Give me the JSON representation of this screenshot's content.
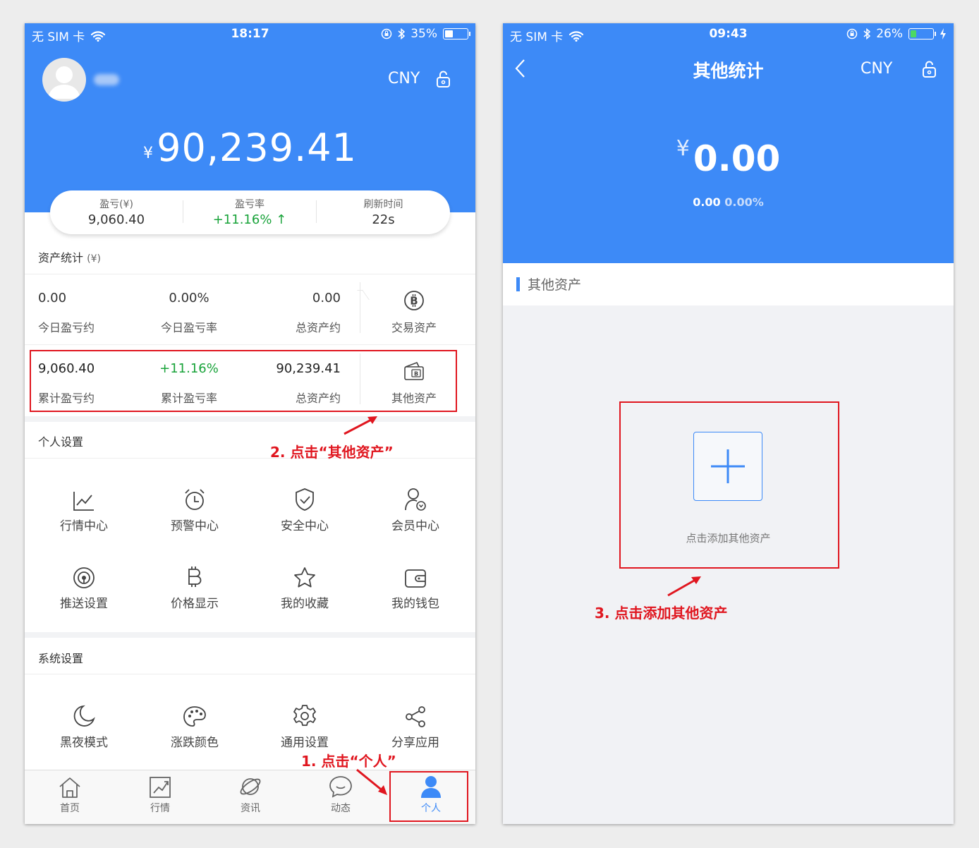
{
  "phone_left": {
    "status": {
      "carrier": "无 SIM 卡",
      "time": "18:17",
      "battery": "35%",
      "battery_level": 0.35
    },
    "currency": "CNY",
    "total": {
      "symbol": "¥",
      "amount": "90,239.41"
    },
    "summary": [
      {
        "label": "盈亏(¥)",
        "value": "9,060.40"
      },
      {
        "label": "盈亏率",
        "value": "+11.16%",
        "arrow": "↑"
      },
      {
        "label": "刷新时间",
        "value": "22s"
      }
    ],
    "asset_stats_title": "资产统计",
    "asset_stats_unit": "(¥)",
    "row1": [
      {
        "value": "0.00",
        "label": "今日盈亏约"
      },
      {
        "value": "0.00%",
        "label": "今日盈亏率"
      },
      {
        "value": "0.00",
        "label": "总资产约"
      }
    ],
    "row1_action": {
      "label": "交易资产",
      "icon": "bitcoin-circle-icon"
    },
    "row2": [
      {
        "value": "9,060.40",
        "label": "累计盈亏约"
      },
      {
        "value": "+11.16%",
        "label": "累计盈亏率"
      },
      {
        "value": "90,239.41",
        "label": "总资产约"
      }
    ],
    "row2_action": {
      "label": "其他资产",
      "icon": "wallet-b-icon"
    },
    "personal_title": "个人设置",
    "personal_items": [
      {
        "label": "行情中心",
        "icon": "chart-line-icon"
      },
      {
        "label": "预警中心",
        "icon": "alarm-clock-icon"
      },
      {
        "label": "安全中心",
        "icon": "shield-check-icon"
      },
      {
        "label": "会员中心",
        "icon": "member-user-icon"
      },
      {
        "label": "推送设置",
        "icon": "broadcast-icon"
      },
      {
        "label": "价格显示",
        "icon": "bitcoin-icon"
      },
      {
        "label": "我的收藏",
        "icon": "star-icon"
      },
      {
        "label": "我的钱包",
        "icon": "wallet-icon"
      }
    ],
    "system_title": "系统设置",
    "system_items": [
      {
        "label": "黑夜模式",
        "icon": "moon-icon"
      },
      {
        "label": "涨跌颜色",
        "icon": "palette-icon"
      },
      {
        "label": "通用设置",
        "icon": "gear-icon"
      },
      {
        "label": "分享应用",
        "icon": "share-icon"
      }
    ],
    "tabs": [
      {
        "label": "首页",
        "icon": "home-icon"
      },
      {
        "label": "行情",
        "icon": "chart-icon"
      },
      {
        "label": "资讯",
        "icon": "planet-icon"
      },
      {
        "label": "动态",
        "icon": "chat-bubble-icon"
      },
      {
        "label": "个人",
        "icon": "person-icon",
        "active": true
      }
    ],
    "annotation_2": "2. 点击“其他资产”",
    "annotation_1": "1. 点击“个人”"
  },
  "phone_right": {
    "status": {
      "carrier": "无 SIM 卡",
      "time": "09:43",
      "battery": "26%",
      "battery_level": 0.26
    },
    "title": "其他统计",
    "currency": "CNY",
    "total": {
      "symbol": "¥",
      "amount": "0.00"
    },
    "change": "0.00",
    "change_pct": "0.00%",
    "section_title": "其他资产",
    "add_label": "点击添加其他资产",
    "annotation_3": "3. 点击添加其他资产"
  },
  "colors": {
    "brand_blue": "#3d8af7",
    "green": "#19a33a",
    "annotation_red": "#e0161f",
    "accent_bar": "#3d8af7"
  }
}
